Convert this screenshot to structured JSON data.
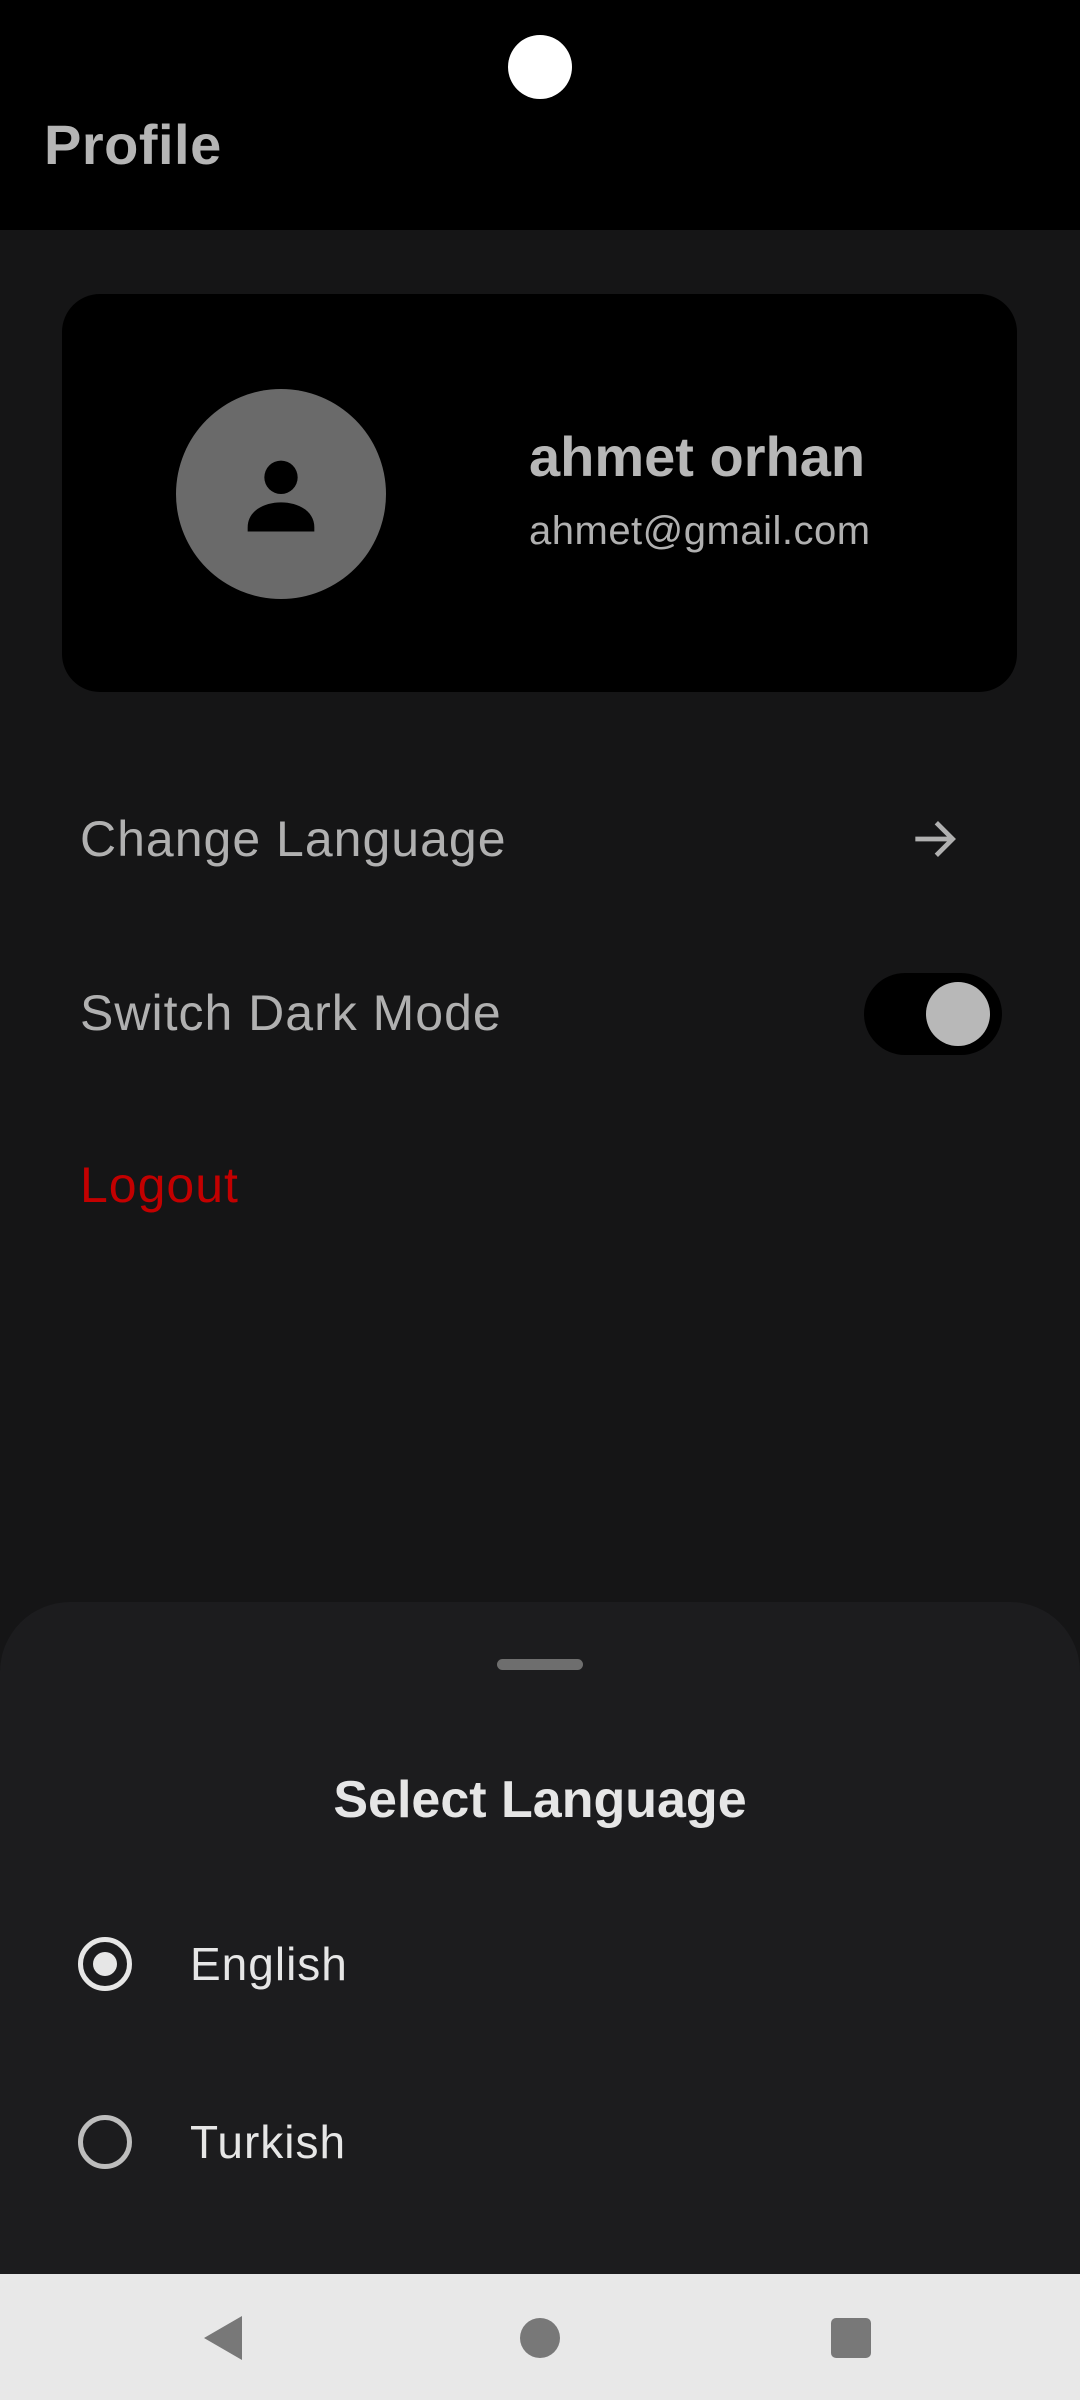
{
  "appbar": {
    "title": "Profile"
  },
  "profile": {
    "name": "ahmet orhan",
    "email": "ahmet@gmail.com",
    "avatar_icon": "person-icon"
  },
  "menu": {
    "change_language": "Change Language",
    "switch_dark_mode": "Switch Dark Mode",
    "dark_mode_enabled": true,
    "logout": "Logout"
  },
  "language_sheet": {
    "title": "Select Language",
    "options": [
      {
        "label": "English",
        "selected": true
      },
      {
        "label": "Turkish",
        "selected": false
      }
    ]
  },
  "colors": {
    "background": "#151516",
    "card": "#000000",
    "logout": "#c30000",
    "sheet": "#1c1c1e",
    "navbar": "#e8e8e8"
  },
  "navbar": {
    "icons": [
      "back-icon",
      "home-icon",
      "recents-icon"
    ]
  }
}
